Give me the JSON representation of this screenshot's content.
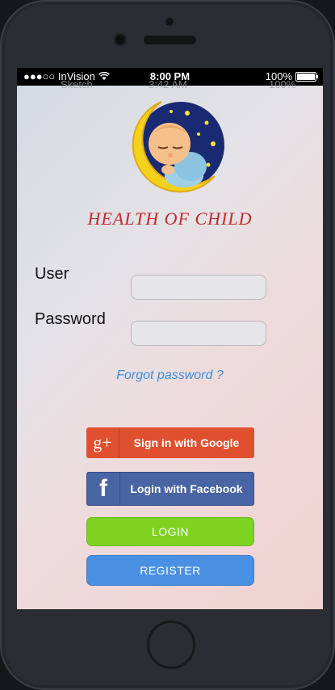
{
  "statusbar": {
    "carrier": "●●●○○ InVision",
    "time": "8:00 PM",
    "battery": "100%"
  },
  "ghost_status": {
    "left": "Sketch",
    "time": "3:42 AM",
    "right": "100%"
  },
  "app": {
    "title": "HEALTH OF CHILD"
  },
  "form": {
    "user_label": "User",
    "password_label": "Password",
    "user_value": "",
    "password_value": "",
    "forgot_label": "Forgot password ?"
  },
  "social": {
    "google_icon": "g+",
    "google_label": "Sign in with Google",
    "facebook_icon": "f",
    "facebook_label": "Login with Facebook"
  },
  "buttons": {
    "login_label": "LOGIN",
    "register_label": "REGISTER"
  },
  "colors": {
    "title": "#c4282a",
    "link": "#3d8ddb",
    "google": "#e05030",
    "facebook": "#4a65a4",
    "login": "#7ed321",
    "register": "#4a90e2"
  }
}
